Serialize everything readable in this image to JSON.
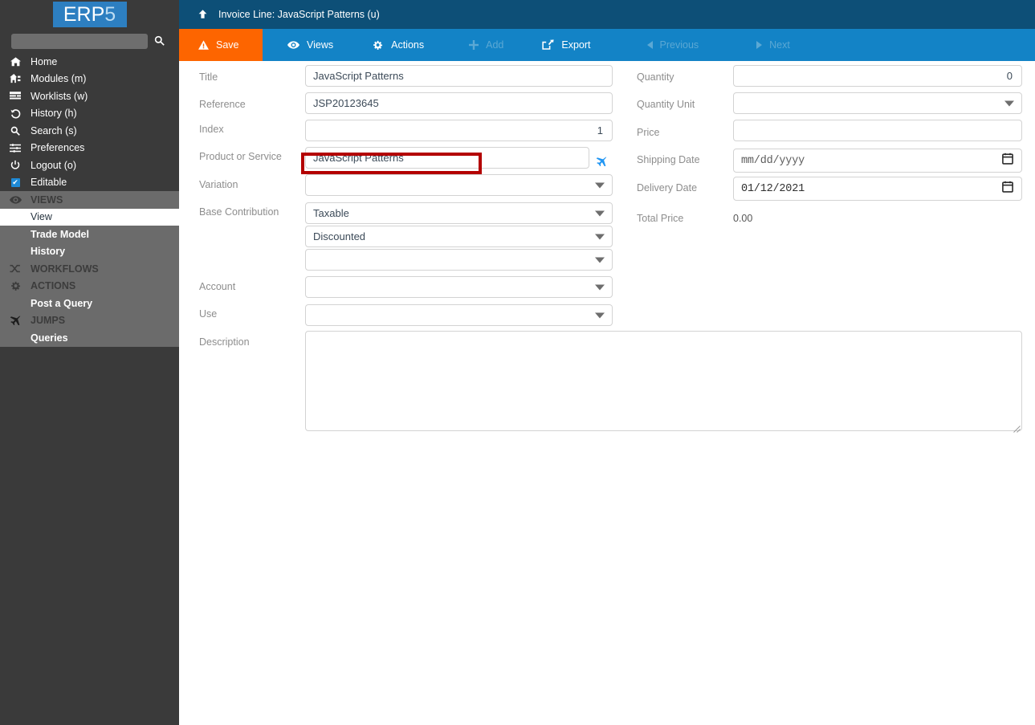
{
  "brand": {
    "logo_main": "ERP",
    "logo_digit": "5",
    "logo_bg": "#2d7fc1"
  },
  "sidebar": {
    "search_placeholder": "",
    "search_value": "",
    "search_icon": "search-icon",
    "top_items": [
      {
        "label": "Home",
        "icon": "home-icon"
      },
      {
        "label": "Modules (m)",
        "icon": "modules-icon"
      },
      {
        "label": "Worklists (w)",
        "icon": "worklists-icon"
      },
      {
        "label": "History (h)",
        "icon": "history-icon"
      },
      {
        "label": "Search (s)",
        "icon": "search-icon"
      },
      {
        "label": "Preferences",
        "icon": "sliders-icon"
      },
      {
        "label": "Logout (o)",
        "icon": "power-icon"
      },
      {
        "label": "Editable",
        "icon": "checkbox-checked-icon"
      }
    ],
    "groups": [
      {
        "label": "VIEWS",
        "icon": "eye-icon"
      },
      {
        "label": "View",
        "icon": "",
        "selected": true
      },
      {
        "label": "Trade Model",
        "icon": ""
      },
      {
        "label": "History",
        "icon": ""
      },
      {
        "label": "WORKFLOWS",
        "icon": "shuffle-icon"
      },
      {
        "label": "ACTIONS",
        "icon": "gears-icon"
      },
      {
        "label": "Post a Query",
        "icon": ""
      },
      {
        "label": "JUMPS",
        "icon": "plane-icon"
      },
      {
        "label": "Queries",
        "icon": ""
      }
    ]
  },
  "titlebar": {
    "up_icon": "arrow-up-icon",
    "title": "Invoice Line: JavaScript Patterns (u)",
    "bg": "#0d4f77"
  },
  "toolbar": {
    "save": {
      "label": "Save",
      "icon": "warning-triangle-icon",
      "bg": "#fd6500",
      "disabled": false
    },
    "views": {
      "label": "Views",
      "icon": "eye-icon",
      "disabled": false
    },
    "actions": {
      "label": "Actions",
      "icon": "gears-icon",
      "disabled": false
    },
    "add": {
      "label": "Add",
      "icon": "plus-icon",
      "disabled": true
    },
    "export": {
      "label": "Export",
      "icon": "export-icon",
      "disabled": false
    },
    "previous": {
      "label": "Previous",
      "icon": "caret-left-icon",
      "disabled": true
    },
    "next": {
      "label": "Next",
      "icon": "caret-right-icon",
      "disabled": true
    },
    "bg": "#1383c6"
  },
  "form": {
    "left": {
      "title": {
        "label": "Title",
        "value": "JavaScript Patterns"
      },
      "reference": {
        "label": "Reference",
        "value": "JSP20123645"
      },
      "index": {
        "label": "Index",
        "value": "1"
      },
      "product_or_service": {
        "label": "Product or Service",
        "value": "JavaScript Patterns",
        "jump_icon": "plane-icon"
      },
      "variation": {
        "label": "Variation",
        "value": ""
      },
      "base_contribution": {
        "label": "Base Contribution",
        "value": "Taxable"
      },
      "base_contribution_2": {
        "label": "",
        "value": "Discounted"
      },
      "base_contribution_3": {
        "label": "",
        "value": ""
      },
      "account": {
        "label": "Account",
        "value": ""
      },
      "use": {
        "label": "Use",
        "value": ""
      },
      "description": {
        "label": "Description",
        "value": ""
      }
    },
    "right": {
      "quantity": {
        "label": "Quantity",
        "value": "0"
      },
      "quantity_unit": {
        "label": "Quantity Unit",
        "value": ""
      },
      "price": {
        "label": "Price",
        "value": ""
      },
      "shipping_date": {
        "label": "Shipping Date",
        "value": "",
        "placeholder": "mm/dd/yyyy"
      },
      "delivery_date": {
        "label": "Delivery Date",
        "value": "01/12/2021",
        "placeholder": "mm/dd/yyyy"
      },
      "total_price": {
        "label": "Total Price",
        "value": "0.00"
      }
    }
  },
  "annotation": {
    "color": "#b30000",
    "target": "product-or-service-field"
  }
}
